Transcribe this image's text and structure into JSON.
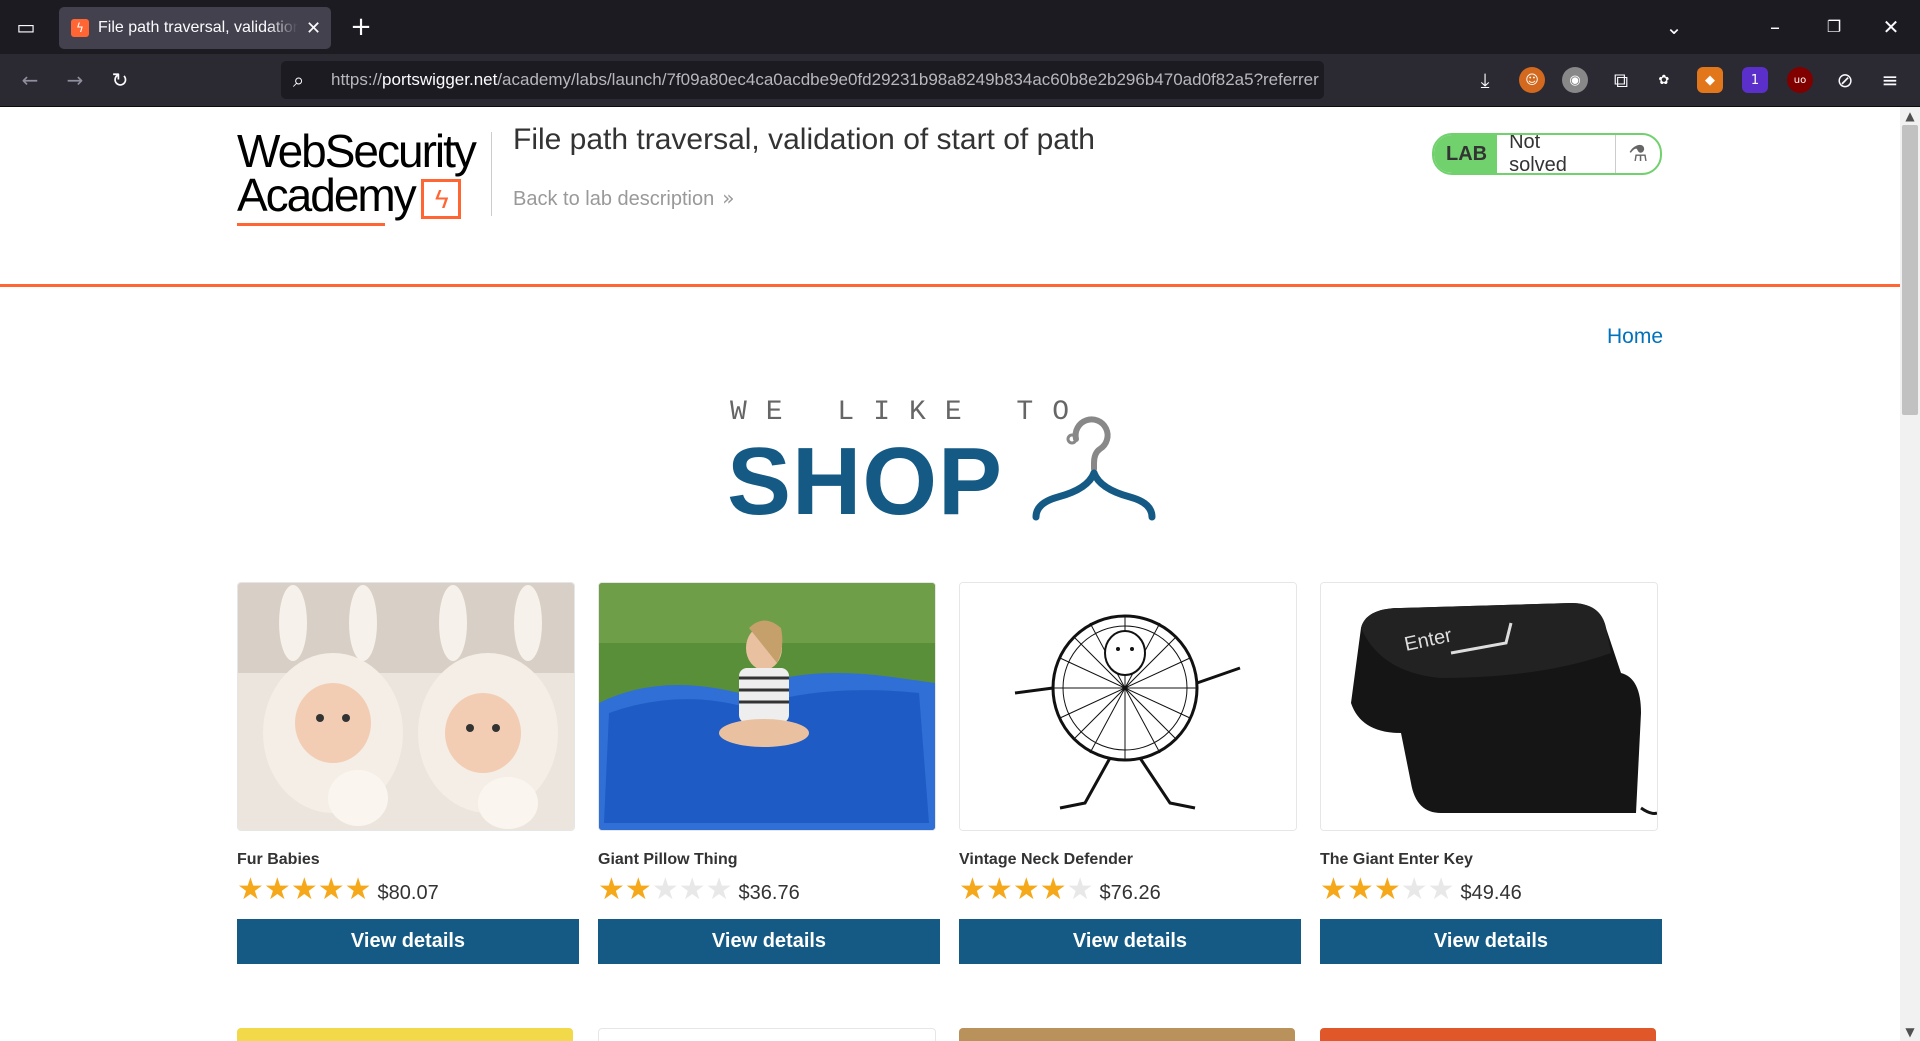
{
  "browser": {
    "tab_title": "File path traversal, validation of start of path",
    "url_prefix": "https://",
    "url_host": "portswigger.net",
    "url_rest": "/academy/labs/launch/7f09a80ec4ca0acdbe9e0fd29231b98a8249b834ac60b8e2b296b470ad0f82a5?referrer",
    "new_tab_glyph": "+",
    "close_glyph": "✕",
    "extension_badge": "1",
    "ublock_text": "uo",
    "colors": {
      "tabbar": "#1c1b22",
      "navbar": "#2b2a33",
      "urlbar": "#1c1b22"
    }
  },
  "header": {
    "logo_line1": "WebSecurity",
    "logo_line2": "Academy",
    "logo_mark": "ϟ",
    "lab_title": "File path traversal, validation of start of path",
    "back_link": "Back to lab description",
    "back_chevron": "»",
    "lab_badge": "LAB",
    "lab_status": "Not solved",
    "flask_icon": "⚗",
    "colors": {
      "accent": "#ff6633",
      "lab_green": "#70d16d"
    }
  },
  "nav": {
    "home": "Home"
  },
  "hero": {
    "subtitle": "WE LIKE TO",
    "title": "SHOP"
  },
  "products": [
    {
      "name": "Fur Babies",
      "rating": 5,
      "price": "$80.07",
      "button": "View details"
    },
    {
      "name": "Giant Pillow Thing",
      "rating": 2,
      "price": "$36.76",
      "button": "View details"
    },
    {
      "name": "Vintage Neck Defender",
      "rating": 4,
      "price": "$76.26",
      "button": "View details"
    },
    {
      "name": "The Giant Enter Key",
      "rating": 3,
      "price": "$49.46",
      "button": "View details"
    }
  ],
  "enter_key_label": "Enter",
  "theme": {
    "primary": "#145a85",
    "star_on": "#f6a81b",
    "star_off": "#e8e8e8",
    "link": "#0071bc"
  }
}
